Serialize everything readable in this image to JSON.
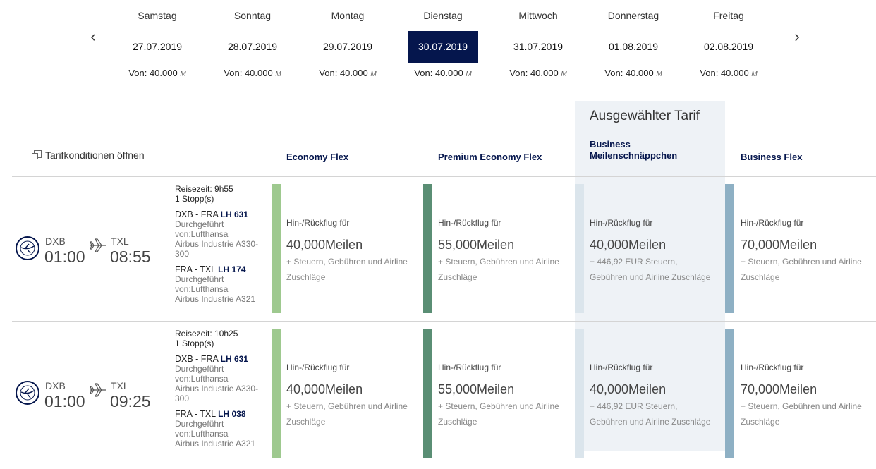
{
  "dates": [
    {
      "weekday": "Samstag",
      "date": "27.07.2019",
      "price": "Von: 40.000",
      "unit": "M"
    },
    {
      "weekday": "Sonntag",
      "date": "28.07.2019",
      "price": "Von: 40.000",
      "unit": "M"
    },
    {
      "weekday": "Montag",
      "date": "29.07.2019",
      "price": "Von: 40.000",
      "unit": "M"
    },
    {
      "weekday": "Dienstag",
      "date": "30.07.2019",
      "price": "Von: 40.000",
      "unit": "M"
    },
    {
      "weekday": "Mittwoch",
      "date": "31.07.2019",
      "price": "Von: 40.000",
      "unit": "M"
    },
    {
      "weekday": "Donnerstag",
      "date": "01.08.2019",
      "price": "Von: 40.000",
      "unit": "M"
    },
    {
      "weekday": "Freitag",
      "date": "02.08.2019",
      "price": "Von: 40.000",
      "unit": "M"
    }
  ],
  "nav": {
    "prev": "‹",
    "next": "›"
  },
  "header": {
    "selected_title": "Ausgewählter Tarif",
    "tarif_link": "Tarifkonditionen öffnen",
    "fares": [
      "Economy Flex",
      "Premium Economy Flex",
      "Business Meilenschnäppchen",
      "Business Flex"
    ]
  },
  "colors": {
    "economy": "#9ec98f",
    "premium": "#5a8e74",
    "business_saver": "#dbe5ec",
    "business_flex": "#8eb0c4",
    "selected_date": "#05164d"
  },
  "flights": [
    {
      "origin": "DXB",
      "dep": "01:00",
      "dest": "TXL",
      "arr": "08:55",
      "duration_label": "Reisezeit:",
      "duration": "9h55",
      "stops": "1 Stopp(s)",
      "segments": [
        {
          "route": "DXB - FRA",
          "flight": "LH 631",
          "op": "Durchgeführt von:Lufthansa",
          "aircraft": "Airbus Industrie A330-300"
        },
        {
          "route": "FRA - TXL",
          "flight": "LH 174",
          "op": "Durchgeführt von:Lufthansa",
          "aircraft": "Airbus Industrie A321"
        }
      ],
      "fares": [
        {
          "label": "Hin-/Rückflug für",
          "miles": "40,000Meilen",
          "taxes": "+ Steuern, Gebühren und Airline Zuschläge"
        },
        {
          "label": "Hin-/Rückflug für",
          "miles": "55,000Meilen",
          "taxes": "+ Steuern, Gebühren und Airline Zuschläge"
        },
        {
          "label": "Hin-/Rückflug für",
          "miles": "40,000Meilen",
          "taxes": "+ 446,92 EUR Steuern, Gebühren und Airline Zuschläge"
        },
        {
          "label": "Hin-/Rückflug für",
          "miles": "70,000Meilen",
          "taxes": "+ Steuern, Gebühren und Airline Zuschläge"
        }
      ]
    },
    {
      "origin": "DXB",
      "dep": "01:00",
      "dest": "TXL",
      "arr": "09:25",
      "duration_label": "Reisezeit:",
      "duration": "10h25",
      "stops": "1 Stopp(s)",
      "segments": [
        {
          "route": "DXB - FRA",
          "flight": "LH 631",
          "op": "Durchgeführt von:Lufthansa",
          "aircraft": "Airbus Industrie A330-300"
        },
        {
          "route": "FRA - TXL",
          "flight": "LH 038",
          "op": "Durchgeführt von:Lufthansa",
          "aircraft": "Airbus Industrie A321"
        }
      ],
      "fares": [
        {
          "label": "Hin-/Rückflug für",
          "miles": "40,000Meilen",
          "taxes": "+ Steuern, Gebühren und Airline Zuschläge"
        },
        {
          "label": "Hin-/Rückflug für",
          "miles": "55,000Meilen",
          "taxes": "+ Steuern, Gebühren und Airline Zuschläge"
        },
        {
          "label": "Hin-/Rückflug für",
          "miles": "40,000Meilen",
          "taxes": "+ 446,92 EUR Steuern, Gebühren und Airline Zuschläge"
        },
        {
          "label": "Hin-/Rückflug für",
          "miles": "70,000Meilen",
          "taxes": "+ Steuern, Gebühren und Airline Zuschläge"
        }
      ]
    }
  ]
}
